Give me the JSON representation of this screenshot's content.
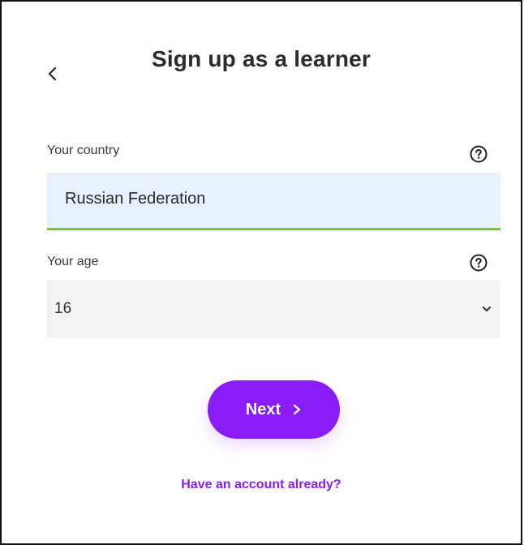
{
  "page": {
    "title": "Sign up as a learner"
  },
  "country": {
    "label": "Your country",
    "value": "Russian Federation"
  },
  "age": {
    "label": "Your age",
    "selected": "16"
  },
  "actions": {
    "next_label": "Next",
    "account_link": "Have an account already?"
  },
  "icons": {
    "back": "chevron-left-icon",
    "help": "question-circle-icon",
    "dropdown": "chevron-down-icon",
    "next": "chevron-right-icon"
  },
  "colors": {
    "accent": "#8a1cf7",
    "focus_underline": "#7dc23c",
    "country_field_bg": "#e8f0fe",
    "age_field_bg": "#f3f3f3"
  }
}
